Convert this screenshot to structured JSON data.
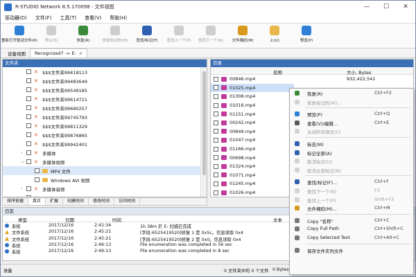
{
  "window": {
    "title": "R-STUDIO Network 8.5.170098 - 文件视图",
    "controls": [
      "—",
      "☐",
      "✕"
    ]
  },
  "menu": [
    "驱动器(D)",
    "文件(F)",
    "工具(T)",
    "查看(V)",
    "帮助(H)"
  ],
  "toolbar": [
    {
      "label": "重新打开驱动文件(R)",
      "icon_color": "#2f7fd6",
      "enabled": true
    },
    {
      "label": "停止(S)",
      "icon_color": "#9a9a9a",
      "enabled": false
    },
    {
      "label": "恢复(R)",
      "icon_color": "#3a8a3a",
      "enabled": true
    },
    {
      "label": "恢复标记的(M)",
      "icon_color": "#9a9a9a",
      "enabled": false
    },
    {
      "label": "查找/标记(F)",
      "icon_color": "#2f5fb0",
      "enabled": true
    },
    {
      "label": "查找上一个(P)",
      "icon_color": "#9a9a9a",
      "enabled": false
    },
    {
      "label": "查找下一个(N)",
      "icon_color": "#9a9a9a",
      "enabled": false
    },
    {
      "label": "文件掩码(M)",
      "icon_color": "#d89a1c",
      "enabled": true
    },
    {
      "label": "上(U)",
      "icon_color": "#e8b84a",
      "enabled": true
    },
    {
      "label": "预览(P)",
      "icon_color": "#2f7fd6",
      "enabled": true
    }
  ],
  "tabs": [
    {
      "label": "设备视图",
      "active": false
    },
    {
      "label": "Recognized7 -> E:",
      "active": true
    }
  ],
  "tree": {
    "header": "文件夹",
    "rows": [
      {
        "label": "$$$文件夹99418113",
        "indent": 0,
        "exp": ""
      },
      {
        "label": "$$$文件夹99483649",
        "indent": 0,
        "exp": ""
      },
      {
        "label": "$$$文件夹99549185",
        "indent": 0,
        "exp": ""
      },
      {
        "label": "$$$文件夹99614721",
        "indent": 0,
        "exp": ""
      },
      {
        "label": "$$$文件夹99680257",
        "indent": 0,
        "exp": ""
      },
      {
        "label": "$$$文件夹99745793",
        "indent": 0,
        "exp": ""
      },
      {
        "label": "$$$文件夹99811329",
        "indent": 0,
        "exp": ""
      },
      {
        "label": "$$$文件夹99876865",
        "indent": 0,
        "exp": ""
      },
      {
        "label": "$$$文件夹99942401",
        "indent": 0,
        "exp": ""
      },
      {
        "label": "多媒体",
        "indent": 0,
        "exp": ">"
      },
      {
        "label": "多媒体视频",
        "indent": 0,
        "exp": "v"
      },
      {
        "label": "MP4 文件",
        "indent": 1,
        "exp": "",
        "selected": true
      },
      {
        "label": "Windows AVI 视频",
        "indent": 1,
        "exp": ""
      },
      {
        "label": "多媒体音频",
        "indent": 0,
        "exp": ">"
      },
      {
        "label": "图形、图片",
        "indent": 0,
        "exp": ">"
      }
    ]
  },
  "left_tabs": [
    "排序依据",
    "真正",
    "扩展",
    "创建时间",
    "修改时间",
    "访问时间"
  ],
  "files": {
    "header": "目录",
    "col_name": "名称",
    "col_size": "大小, Bytes",
    "rows": [
      {
        "name": "00846.mp4",
        "size": "832,422,541"
      },
      {
        "name": "01025.mp4",
        "size": "",
        "selected": true
      },
      {
        "name": "01308.mp4",
        "size": ""
      },
      {
        "name": "01016.mp4",
        "size": ""
      },
      {
        "name": "01151.mp4",
        "size": ""
      },
      {
        "name": "00242.mp4",
        "size": ""
      },
      {
        "name": "00849.mp4",
        "size": ""
      },
      {
        "name": "01047.mp4",
        "size": ""
      },
      {
        "name": "01166.mp4",
        "size": ""
      },
      {
        "name": "00698.mp4",
        "size": ""
      },
      {
        "name": "01324.mp4",
        "size": ""
      },
      {
        "name": "01071.mp4",
        "size": ""
      },
      {
        "name": "01245.mp4",
        "size": ""
      },
      {
        "name": "01026.mp4",
        "size": ""
      }
    ]
  },
  "log": {
    "header": "日志",
    "cols": {
      "type": "类型",
      "date": "日期",
      "time": "时间",
      "text": "文本"
    },
    "rows": [
      {
        "type": "系统",
        "date": "2017/12/16",
        "time": "2:41:34",
        "text": "1h 38m 於 E: 扫描已完成",
        "warn": false
      },
      {
        "type": "文件系统",
        "date": "2017/12/16",
        "time": "2:45:21",
        "text": "[字段:6525419520]修复 1 是 0x5c。信息读取 0x4",
        "warn": true
      },
      {
        "type": "文件系统",
        "date": "2017/12/16",
        "time": "2:45:21",
        "text": "[字段:6525419520]修复 2 是 0x0。信息读取 0x4",
        "warn": true
      },
      {
        "type": "系统",
        "date": "2017/12/16",
        "time": "2:46:13",
        "text": "File enumeration was completed in 56 sec",
        "warn": false
      },
      {
        "type": "系统",
        "date": "2017/12/16",
        "time": "2:46:13",
        "text": "File enumeration was completed in 8 sec",
        "warn": false
      }
    ]
  },
  "status": {
    "left": "准备",
    "count": "0 文件夹中的 0 个文件",
    "bytes": "0 Bytes"
  },
  "context_menu": [
    {
      "label": "恢复(R)",
      "shortcut": "Ctrl+F2",
      "icon_color": "#3a8a3a",
      "enabled": true
    },
    {
      "label": "恢复标记的(M)...",
      "shortcut": "",
      "icon_color": "#9a9a9a",
      "enabled": false
    },
    {
      "sep": true
    },
    {
      "label": "预览(P)",
      "shortcut": "Ctrl+Q",
      "icon_color": "#2f7fd6",
      "enabled": true
    },
    {
      "label": "查看(V)/编辑...",
      "shortcut": "Ctrl+E",
      "icon_color": "#5a5a5a",
      "enabled": true
    },
    {
      "label": "关闭所有预览(C)",
      "shortcut": "",
      "icon_color": "#9a9a9a",
      "enabled": false
    },
    {
      "sep": true
    },
    {
      "label": "标志(M)",
      "shortcut": "",
      "icon_color": "#2f5fb0",
      "enabled": true
    },
    {
      "label": "标记全部(A)",
      "shortcut": "",
      "icon_color": "#2f5fb0",
      "enabled": true
    },
    {
      "label": "取消标记(U)",
      "shortcut": "",
      "icon_color": "#9a9a9a",
      "enabled": false
    },
    {
      "label": "取消全部标记(N)",
      "shortcut": "",
      "icon_color": "#9a9a9a",
      "enabled": false
    },
    {
      "sep": true
    },
    {
      "label": "查找/标记(F)...",
      "shortcut": "Ctrl+F",
      "icon_color": "#2f5fb0",
      "enabled": true
    },
    {
      "label": "查找下一个(N)",
      "shortcut": "F3",
      "icon_color": "#9a9a9a",
      "enabled": false
    },
    {
      "label": "查找上一个(P)",
      "shortcut": "Shift+F3",
      "icon_color": "#9a9a9a",
      "enabled": false
    },
    {
      "label": "文件掩码(M)...",
      "shortcut": "Ctrl+M",
      "icon_color": "#d89a1c",
      "enabled": true
    },
    {
      "sep": true
    },
    {
      "label": "Copy \"名称\"",
      "shortcut": "Ctrl+C",
      "icon_color": "#777777",
      "enabled": true
    },
    {
      "label": "Copy Full Path",
      "shortcut": "Ctrl+Shift+C",
      "icon_color": "#777777",
      "enabled": true
    },
    {
      "label": "Copy Selected Text",
      "shortcut": "Ctrl+Alt+C",
      "icon_color": "#777777",
      "enabled": true
    },
    {
      "sep": true
    },
    {
      "label": "保存文件实列文件",
      "shortcut": "",
      "icon_color": "#777777",
      "enabled": true
    }
  ]
}
